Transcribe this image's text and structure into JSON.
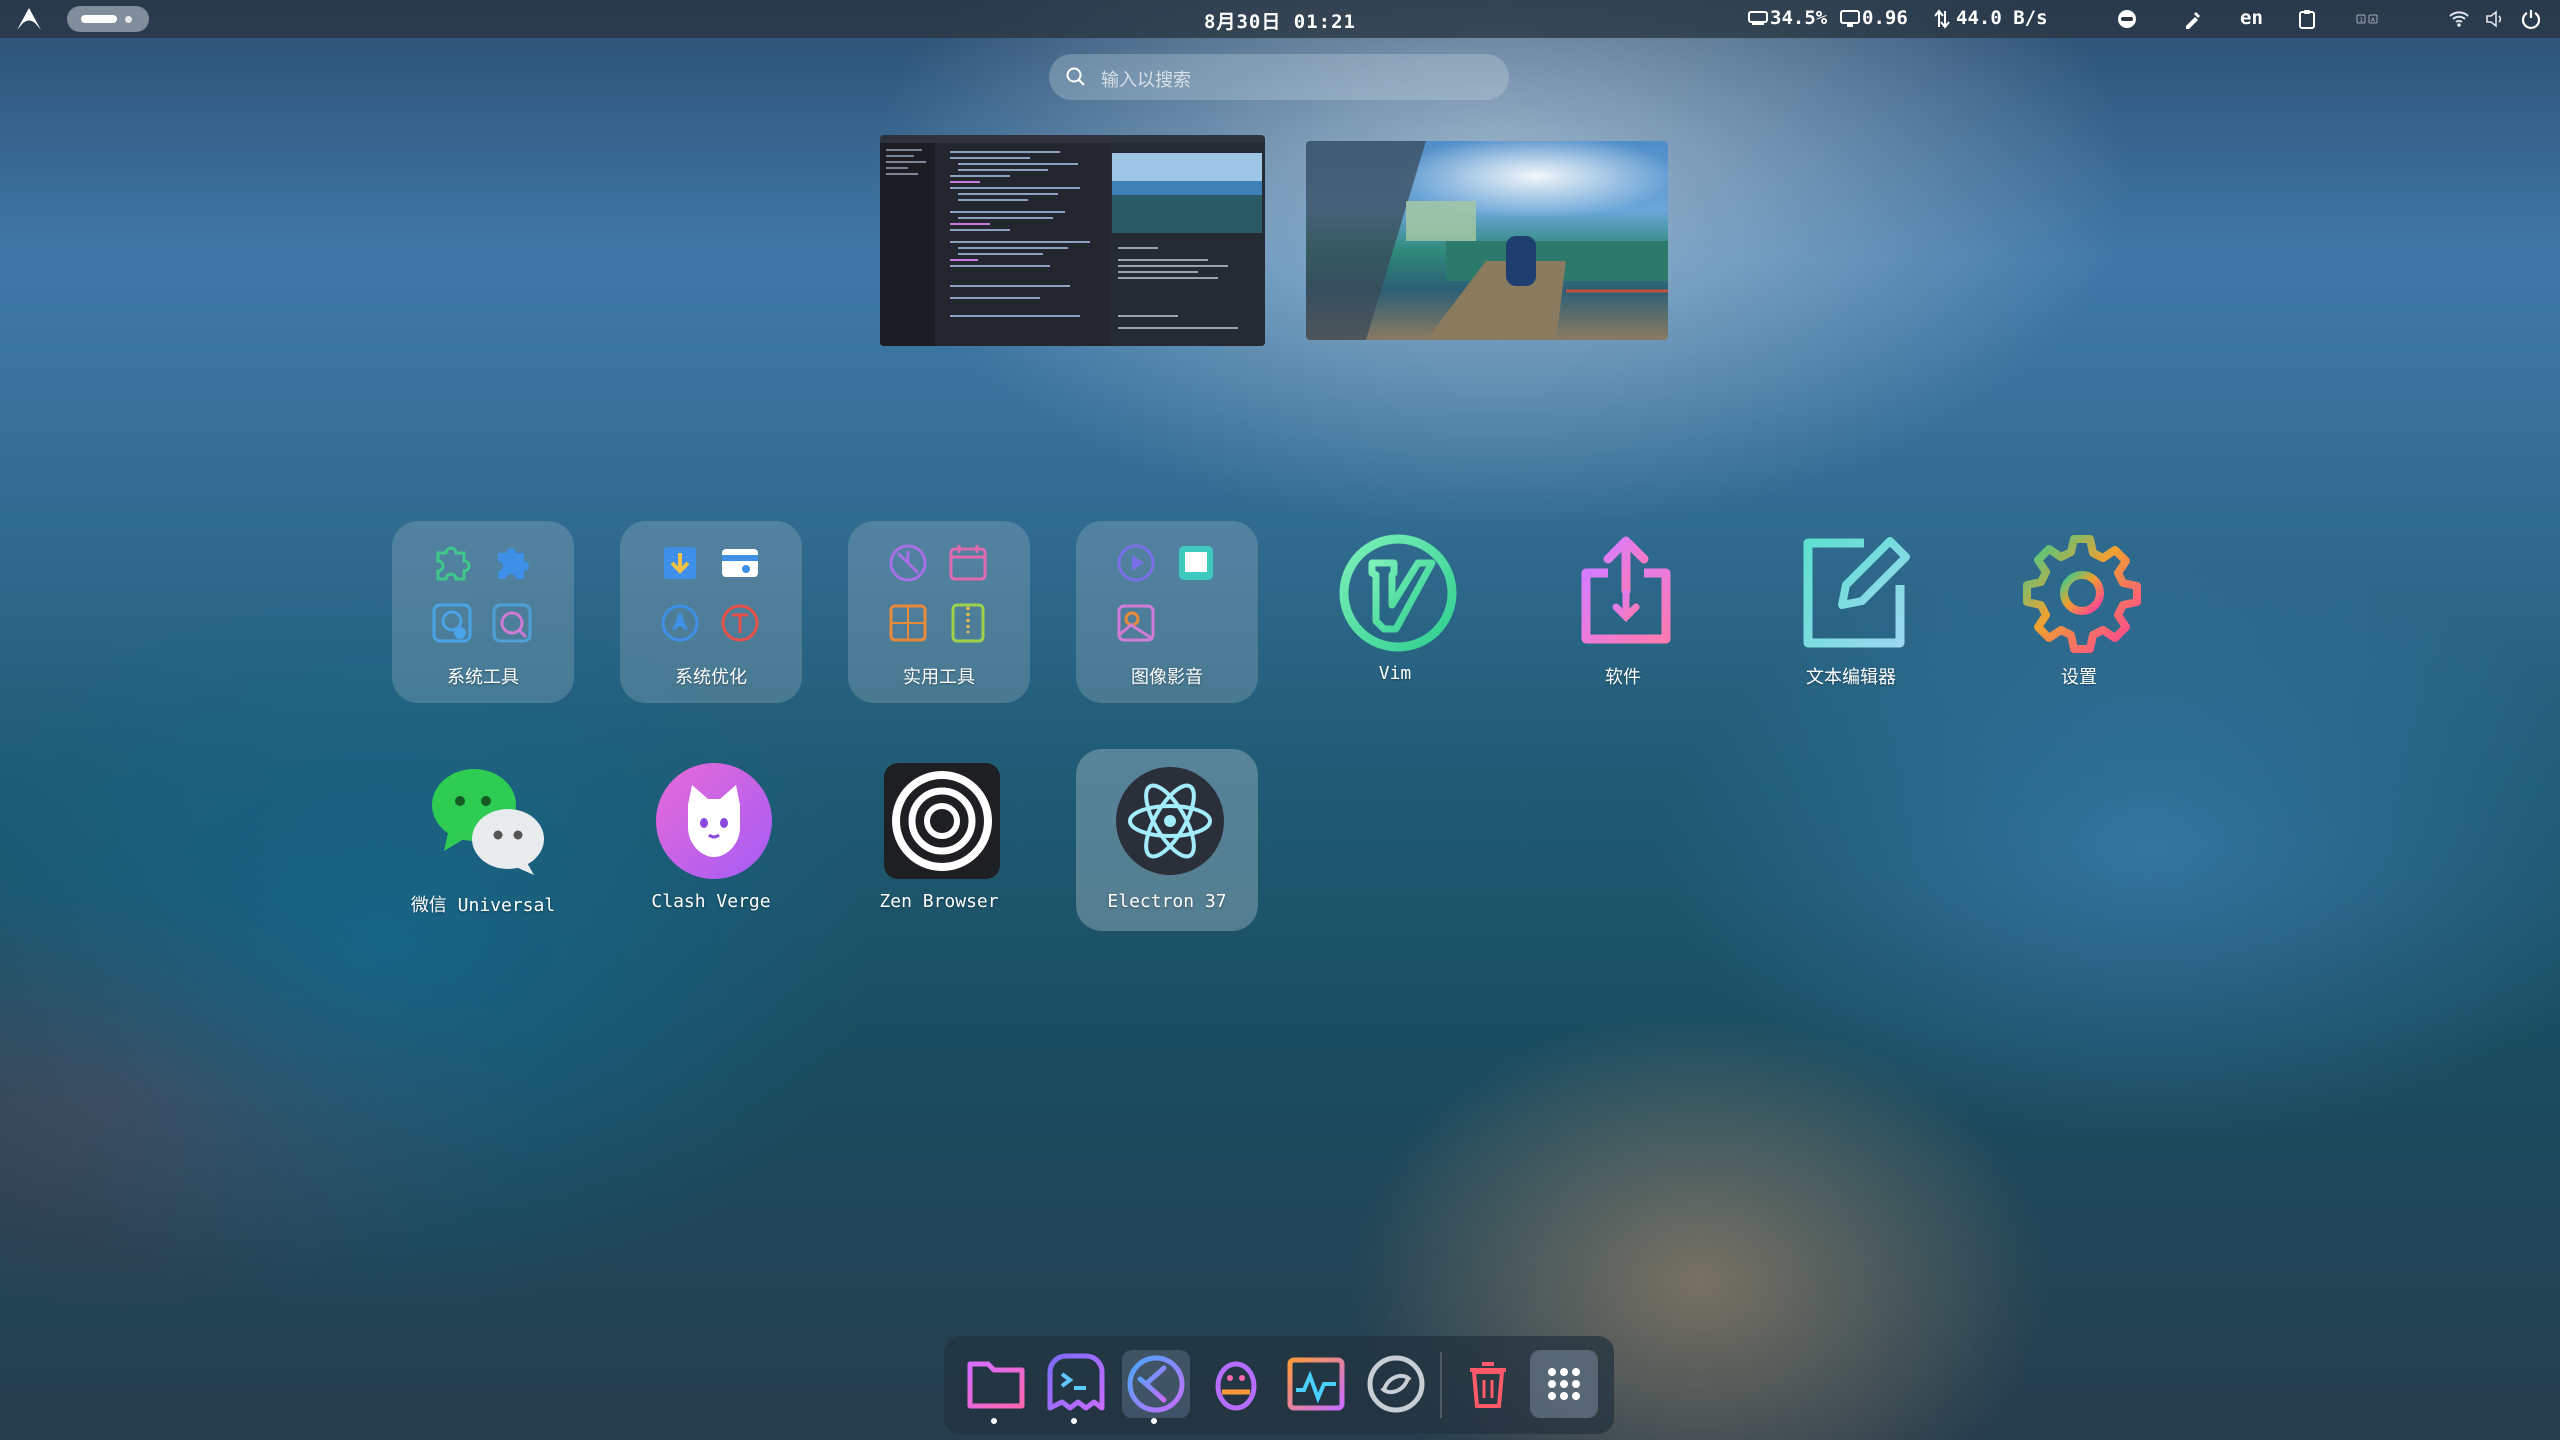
{
  "topbar": {
    "datetime": "8月30日 01:21",
    "cpu": "34.5%",
    "load": "0.96",
    "net": "44.0 B/s",
    "lang": "en",
    "icons": [
      "arch-logo-icon",
      "workspace-indicator",
      "cpu-icon",
      "monitor-icon",
      "network-speed-icon",
      "gamepad-icon",
      "color-picker-icon",
      "clipboard-icon",
      "keyboard-layout-icon",
      "wifi-icon",
      "volume-icon",
      "power-icon"
    ]
  },
  "search": {
    "placeholder": "输入以搜索"
  },
  "windows": [
    "editor-window-thumbnail",
    "wallpaper-window-thumbnail"
  ],
  "apps": [
    {
      "label": "系统工具",
      "type": "folder"
    },
    {
      "label": "系统优化",
      "type": "folder"
    },
    {
      "label": "实用工具",
      "type": "folder"
    },
    {
      "label": "图像影音",
      "type": "folder"
    },
    {
      "label": "Vim",
      "icon": "vim-icon"
    },
    {
      "label": "软件",
      "icon": "software-install-icon"
    },
    {
      "label": "文本编辑器",
      "icon": "text-editor-icon"
    },
    {
      "label": "设置",
      "icon": "settings-gear-icon"
    },
    {
      "label": "微信 Universal",
      "icon": "wechat-icon"
    },
    {
      "label": "Clash Verge",
      "icon": "clash-verge-cat-icon"
    },
    {
      "label": "Zen Browser",
      "icon": "zen-browser-icon"
    },
    {
      "label": "Electron 37",
      "icon": "electron-icon"
    }
  ],
  "dock": [
    "files-icon",
    "terminal-icon",
    "vscode-icon",
    "qq-penguin-icon",
    "system-monitor-icon",
    "browser-icon",
    "trash-icon",
    "app-grid-icon"
  ],
  "colors": {
    "accent": "#d46cff",
    "panel": "#283440"
  }
}
